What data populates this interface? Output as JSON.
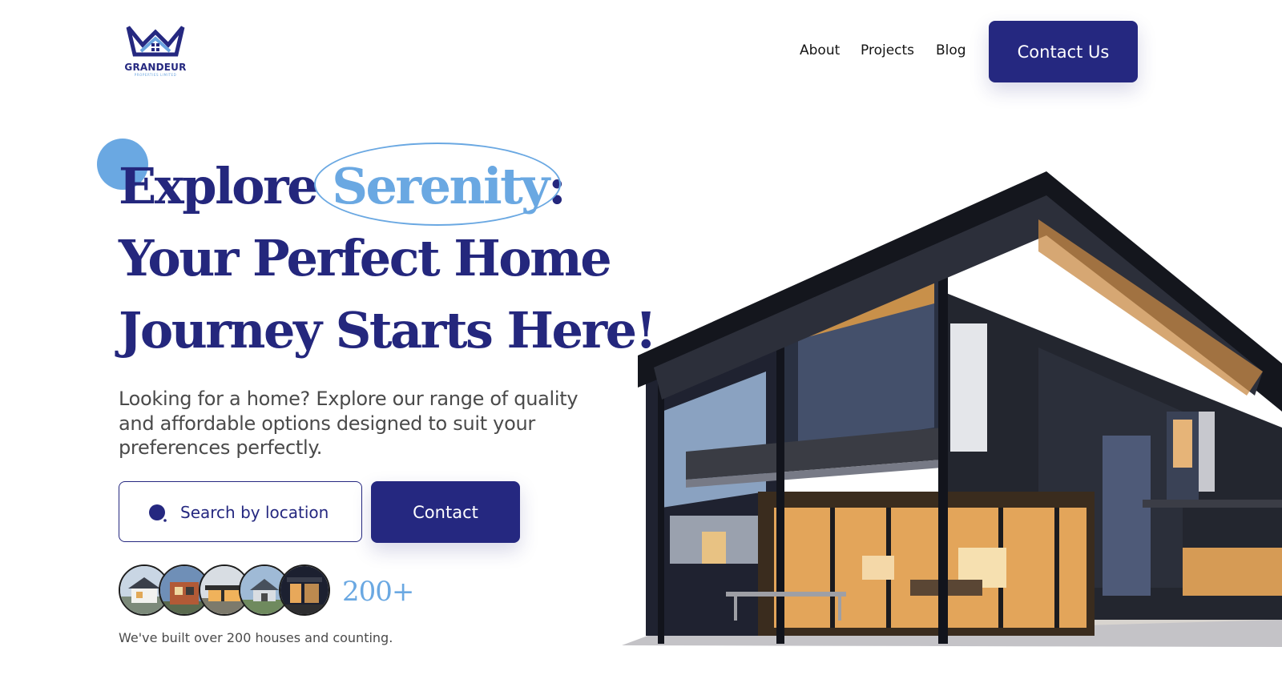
{
  "brand": {
    "name": "GRANDEUR",
    "tagline": "PROPERTIES LIMITED",
    "logo_icon": "crown-house-icon",
    "primary_color": "#252880",
    "accent_color": "#6aa8e2"
  },
  "nav": {
    "items": [
      {
        "label": "About"
      },
      {
        "label": "Projects"
      },
      {
        "label": "Blog"
      }
    ],
    "cta_label": "Contact Us"
  },
  "hero": {
    "headline_part1": "Explore ",
    "headline_highlight": "Serenity",
    "headline_colon": ":",
    "headline_line2": "Your Perfect Home",
    "headline_line3": "Journey Starts Here!",
    "description": "Looking for a home? Explore our range of quality and affordable options designed to suit your preferences perfectly.",
    "search": {
      "placeholder": "Search by location",
      "value": "",
      "icon": "search-icon"
    },
    "contact_label": "Contact"
  },
  "stats": {
    "value": "200+",
    "caption": "We've built over 200 houses and counting."
  }
}
